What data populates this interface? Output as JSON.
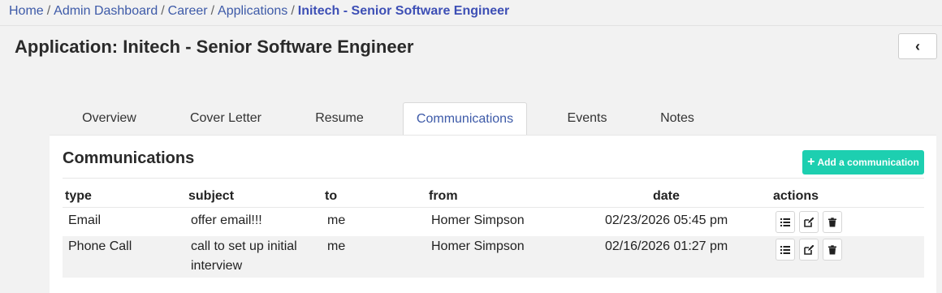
{
  "breadcrumb": {
    "items": [
      "Home",
      "Admin Dashboard",
      "Career",
      "Applications"
    ],
    "separator": "/",
    "current": "Initech - Senior Software Engineer"
  },
  "page": {
    "title": "Application: Initech - Senior Software Engineer",
    "back_label": "‹"
  },
  "tabs": [
    {
      "label": "Overview"
    },
    {
      "label": "Cover Letter"
    },
    {
      "label": "Resume"
    },
    {
      "label": "Communications",
      "active": true
    },
    {
      "label": "Events"
    },
    {
      "label": "Notes"
    }
  ],
  "panel": {
    "title": "Communications",
    "add_label": "Add a communication"
  },
  "table": {
    "headers": [
      "type",
      "subject",
      "to",
      "from",
      "date",
      "actions"
    ],
    "rows": [
      {
        "type": "Email",
        "subject": "offer email!!!",
        "to": "me",
        "from": "Homer Simpson",
        "date": "02/23/2026 05:45 pm"
      },
      {
        "type": "Phone Call",
        "subject": "call to set up initial interview",
        "to": "me",
        "from": "Homer Simpson",
        "date": "02/16/2026 01:27 pm"
      }
    ],
    "actions": [
      "list-icon",
      "edit-icon",
      "trash-icon"
    ]
  },
  "colors": {
    "link": "#3d5aa8",
    "accent": "#1dcfb0",
    "background": "#f2f2f2"
  }
}
